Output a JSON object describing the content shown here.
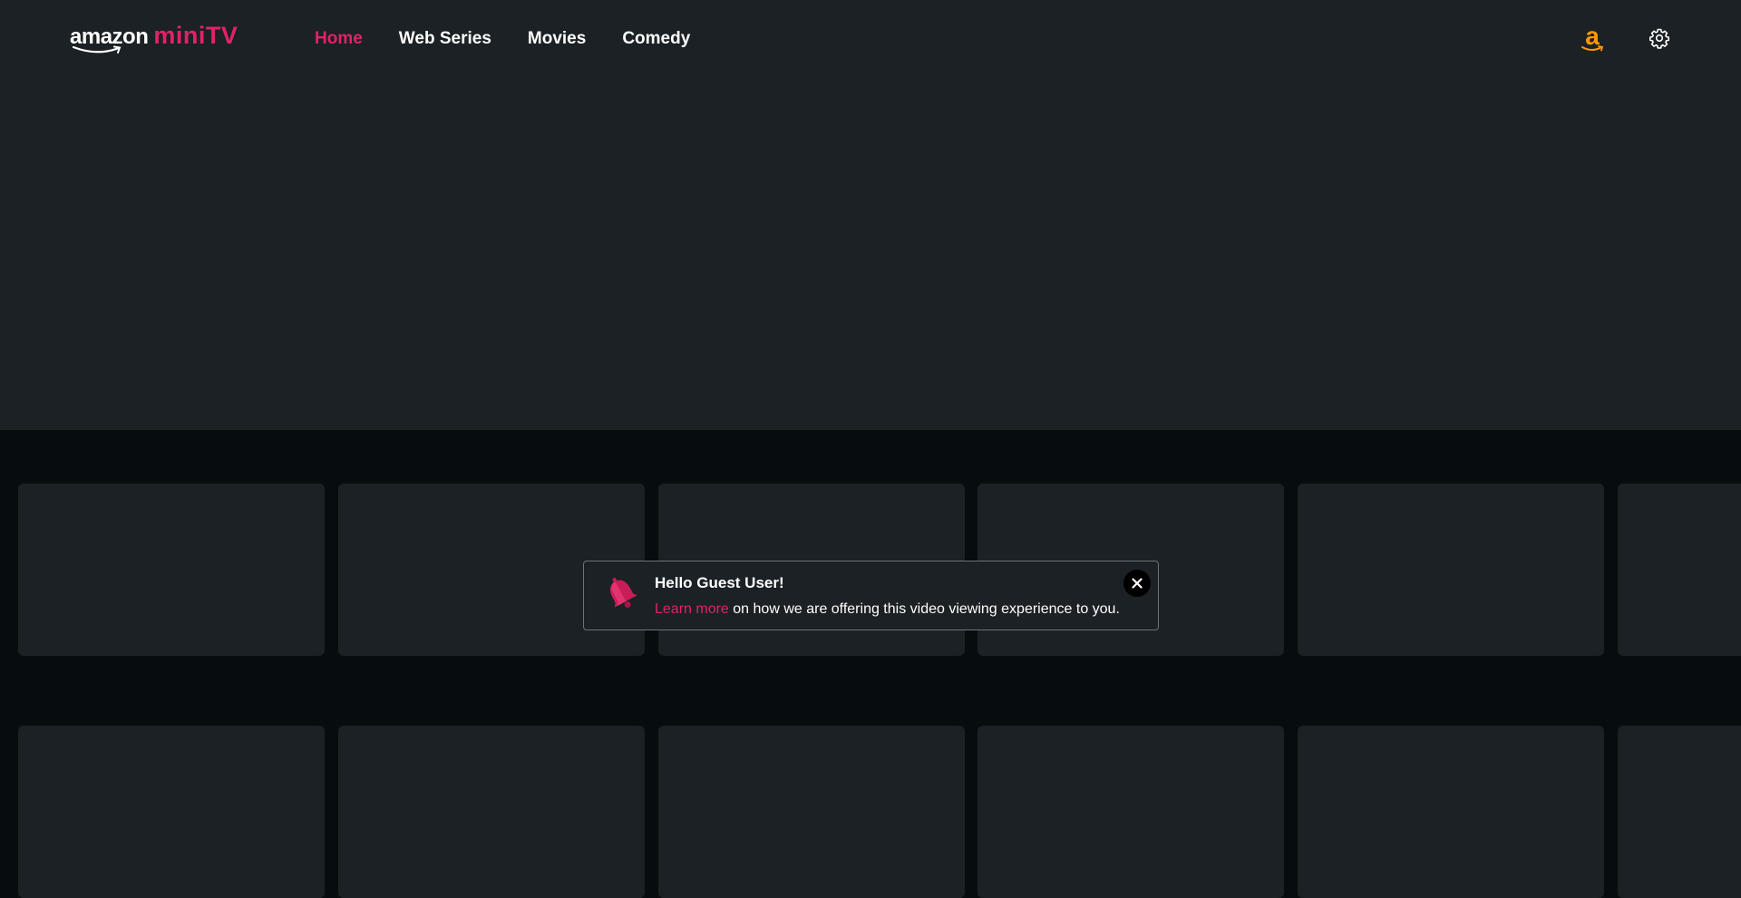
{
  "header": {
    "logo": {
      "amazon": "amazon",
      "minitv": "miniTV"
    },
    "nav": [
      {
        "label": "Home",
        "active": true
      },
      {
        "label": "Web Series",
        "active": false
      },
      {
        "label": "Movies",
        "active": false
      },
      {
        "label": "Comedy",
        "active": false
      }
    ],
    "icons": [
      "amazon-logo-icon",
      "gear-icon"
    ]
  },
  "toast": {
    "title": "Hello Guest User!",
    "link_text": "Learn more",
    "message": " on how we are offering this video viewing experience to you.",
    "icons": [
      "bell-icon",
      "close-icon"
    ]
  },
  "content": {
    "rows": [
      {
        "tiles": 6
      },
      {
        "tiles": 6
      }
    ]
  },
  "colors": {
    "accent": "#e0226b",
    "amazon_orange": "#ff9900",
    "surface": "#1b2124",
    "background": "#070c0f"
  }
}
